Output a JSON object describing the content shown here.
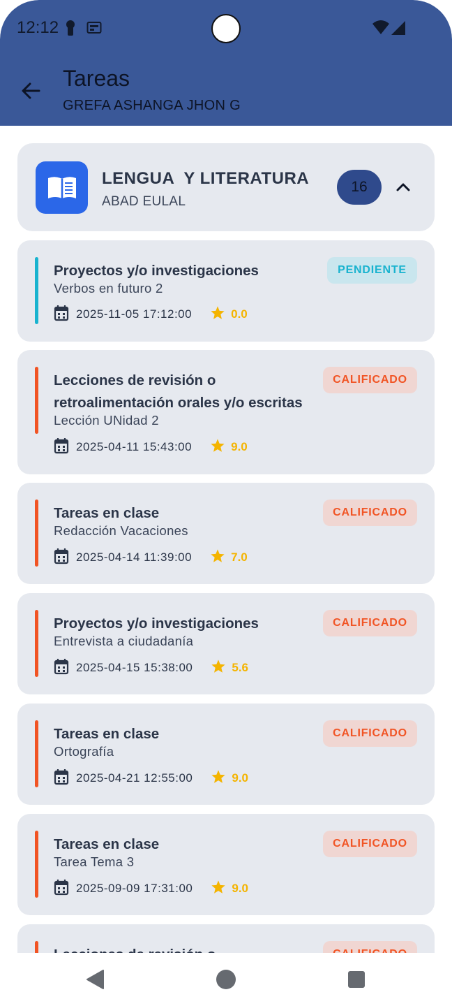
{
  "status_bar": {
    "time": "12:12"
  },
  "header": {
    "title": "Tareas",
    "student": "GREFA ASHANGA JHON G",
    "bg_color": "#3a5898"
  },
  "subject": {
    "name": "LENGUA  Y LITERATURA",
    "teacher": "ABAD EULAL",
    "task_count": "16",
    "icon": "book-icon"
  },
  "tasks": [
    {
      "category": "Proyectos y/o investigaciones",
      "description": "Verbos en futuro 2",
      "date": "2025-11-05 17:12:00",
      "score": "0.0",
      "status": "PENDIENTE",
      "accent": "#19b3cf"
    },
    {
      "category": "Lecciones de revisión o retroalimentación orales y/o escritas",
      "description": "Lección UNidad 2",
      "date": "2025-04-11 15:43:00",
      "score": "9.0",
      "status": "CALIFICADO",
      "accent": "#f15424"
    },
    {
      "category": "Tareas en clase",
      "description": "Redacción Vacaciones",
      "date": "2025-04-14 11:39:00",
      "score": "7.0",
      "status": "CALIFICADO",
      "accent": "#f15424"
    },
    {
      "category": "Proyectos y/o investigaciones",
      "description": "Entrevista a ciudadanía",
      "date": "2025-04-15 15:38:00",
      "score": "5.6",
      "status": "CALIFICADO",
      "accent": "#f15424"
    },
    {
      "category": "Tareas en clase",
      "description": "Ortografía",
      "date": "2025-04-21 12:55:00",
      "score": "9.0",
      "status": "CALIFICADO",
      "accent": "#f15424"
    },
    {
      "category": "Tareas en clase",
      "description": "Tarea Tema 3",
      "date": "2025-09-09 17:31:00",
      "score": "9.0",
      "status": "CALIFICADO",
      "accent": "#f15424"
    },
    {
      "category": "Lecciones de revisión o",
      "status": "CALIFICADO",
      "accent": "#f15424"
    }
  ],
  "colors": {
    "star": "#f4b400",
    "pending": "#19b3cf",
    "graded": "#f15424"
  }
}
